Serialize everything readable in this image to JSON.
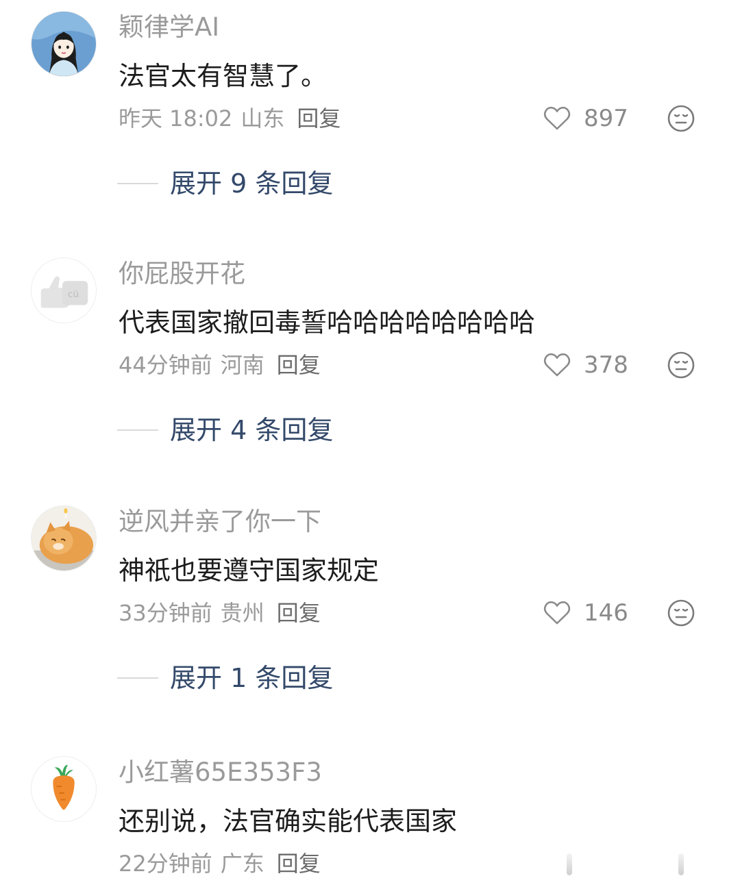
{
  "comments": [
    {
      "username": "颖律学AI",
      "avatar_icon": "girl-avatar-icon",
      "content": "法官太有智慧了。",
      "time": "昨天 18:02",
      "location": "山东",
      "reply_label": "回复",
      "likes": "897",
      "expand_label": "展开 9 条回复"
    },
    {
      "username": "你屁股开花",
      "avatar_icon": "thumbs-up-avatar-icon",
      "content": "代表国家撤回毒誓哈哈哈哈哈哈哈哈",
      "time": "44分钟前",
      "location": "河南",
      "reply_label": "回复",
      "likes": "378",
      "expand_label": "展开 4 条回复"
    },
    {
      "username": "逆风并亲了你一下",
      "avatar_icon": "cat-avatar-icon",
      "content": "神祇也要遵守国家规定",
      "time": "33分钟前",
      "location": "贵州",
      "reply_label": "回复",
      "likes": "146",
      "expand_label": "展开 1 条回复"
    },
    {
      "username": "小红薯65E353F3",
      "avatar_icon": "carrot-avatar-icon",
      "content": "还别说，法官确实能代表国家",
      "time": "22分钟前",
      "location": "广东",
      "reply_label": "回复"
    }
  ],
  "colors": {
    "username": "#9a9a9a",
    "content": "#1c1c1c",
    "expand_link": "#33496a"
  }
}
